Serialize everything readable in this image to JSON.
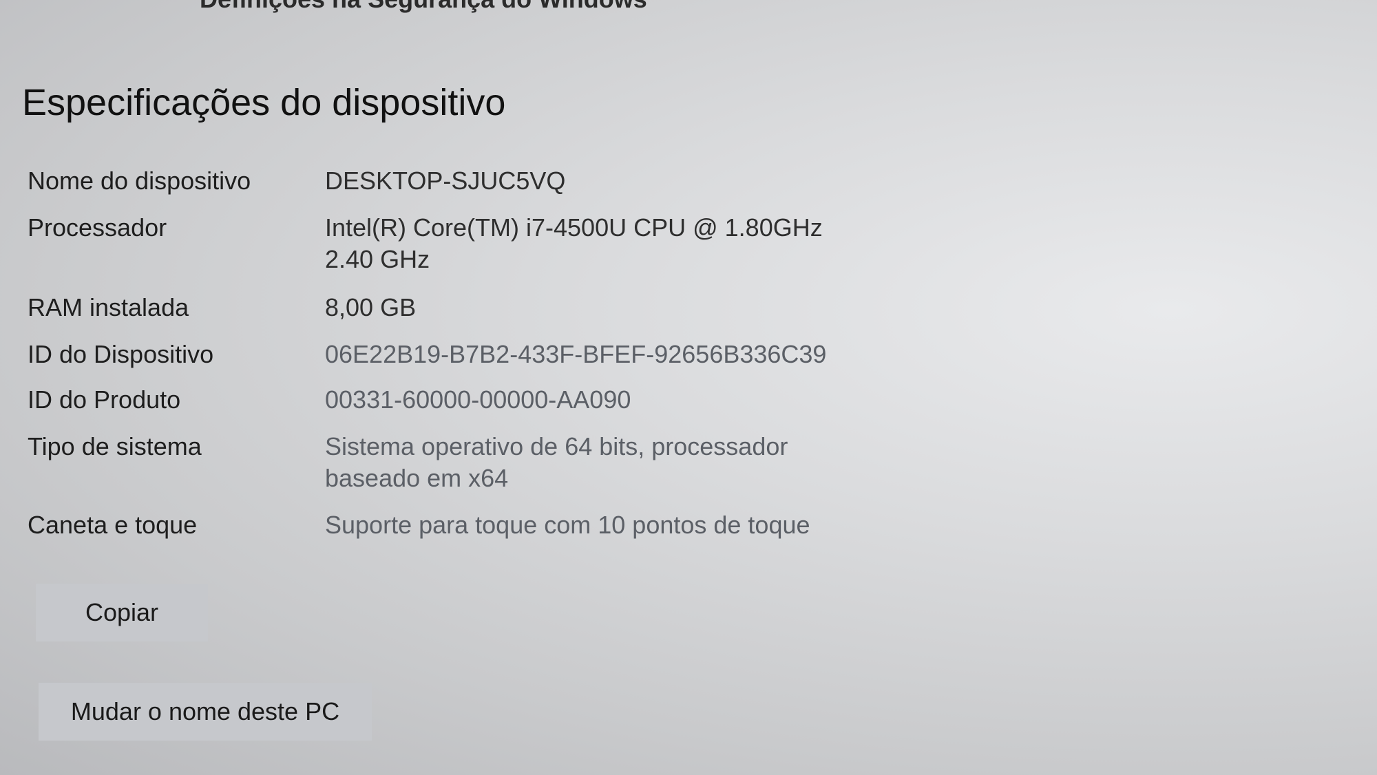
{
  "header": {
    "top_link_partial": "Definições na Segurança do Windows"
  },
  "section": {
    "title": "Especificações do dispositivo"
  },
  "specs": [
    {
      "label": "Nome do dispositivo",
      "value": [
        "DESKTOP-SJUC5VQ"
      ]
    },
    {
      "label": "Processador",
      "value": [
        "Intel(R) Core(TM) i7-4500U CPU @ 1.80GHz",
        "2.40 GHz"
      ]
    },
    {
      "label": "RAM instalada",
      "value": [
        "8,00 GB"
      ]
    },
    {
      "label": "ID do Dispositivo",
      "value": [
        "06E22B19-B7B2-433F-BFEF-92656B336C39"
      ]
    },
    {
      "label": "ID do Produto",
      "value": [
        "00331-60000-00000-AA090"
      ]
    },
    {
      "label": "Tipo de sistema",
      "value": [
        "Sistema operativo de 64 bits, processador",
        "baseado em x64"
      ]
    },
    {
      "label": "Caneta e toque",
      "value": [
        "Suporte para toque com 10 pontos de toque"
      ]
    }
  ],
  "buttons": {
    "copy_label": "Copiar",
    "rename_label": "Mudar o nome deste PC"
  }
}
